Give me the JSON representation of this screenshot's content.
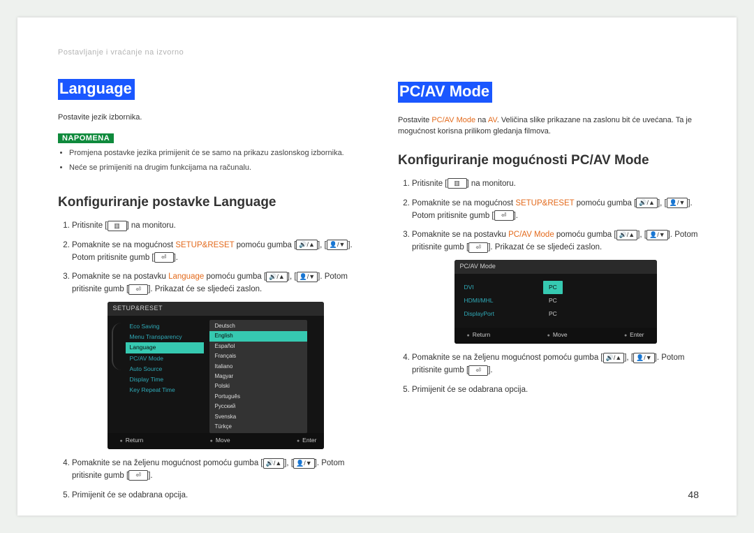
{
  "breadcrumb": "Postavljanje i vraćanje na izvorno",
  "pageNumber": "48",
  "left": {
    "heading": "Language",
    "intro": "Postavite jezik izbornika.",
    "noteLabel": "NAPOMENA",
    "notes": [
      "Promjena postavke jezika primijenit će se samo na prikazu zaslonskog izbornika.",
      "Neće se primijeniti na drugim funkcijama na računalu."
    ],
    "subheading": "Konfiguriranje postavke Language",
    "s1a": "Pritisnite [",
    "s1b": "] na monitoru.",
    "s2a": "Pomaknite se na mogućnost ",
    "s2kw": "SETUP&RESET",
    "s2b": " pomoću gumba [",
    "s2c": "], [",
    "s2d": "]. Potom pritisnite gumb [",
    "s2e": "].",
    "s3a": "Pomaknite se na postavku ",
    "s3kw": "Language",
    "s3b": " pomoću gumba [",
    "s3c": "], [",
    "s3d": "]. Potom pritisnite gumb [",
    "s3e": "]. Prikazat će se sljedeći zaslon.",
    "s4a": "Pomaknite se na željenu mogućnost pomoću gumba [",
    "s4b": "], [",
    "s4c": "]. Potom pritisnite gumb [",
    "s4d": "].",
    "s5": "Primijenit će se odabrana opcija."
  },
  "right": {
    "heading": "PC/AV Mode",
    "introA": "Postavite ",
    "introKW1": "PC/AV Mode",
    "introB": " na ",
    "introKW2": "AV",
    "introC": ". Veličina slike prikazane na zaslonu bit će uvećana. Ta je mogućnost korisna prilikom gledanja filmova.",
    "subheading": "Konfiguriranje mogućnosti PC/AV Mode",
    "s1a": "Pritisnite [",
    "s1b": "] na monitoru.",
    "s2a": "Pomaknite se na mogućnost ",
    "s2kw": "SETUP&RESET",
    "s2b": " pomoću gumba [",
    "s2c": "], [",
    "s2d": "]. Potom pritisnite gumb [",
    "s2e": "].",
    "s3a": "Pomaknite se na postavku ",
    "s3kw": "PC/AV Mode",
    "s3b": " pomoću gumba [",
    "s3c": "], [",
    "s3d": "]. Potom pritisnite gumb [",
    "s3e": "]. Prikazat će se sljedeći zaslon.",
    "s4a": "Pomaknite se na željenu mogućnost pomoću gumba [",
    "s4b": "], [",
    "s4c": "]. Potom pritisnite gumb [",
    "s4d": "].",
    "s5": "Primijenit će se odabrana opcija."
  },
  "osd1": {
    "title": "SETUP&RESET",
    "menu": [
      "Eco Saving",
      "Menu Transparency",
      "Language",
      "PC/AV Mode",
      "Auto Source",
      "Display Time",
      "Key Repeat Time"
    ],
    "selectedMenuIndex": 2,
    "langs": [
      "Deutsch",
      "English",
      "Español",
      "Français",
      "Italiano",
      "Magyar",
      "Polski",
      "Português",
      "Русский",
      "Svenska",
      "Türkçe"
    ],
    "selectedLangIndex": 1,
    "footer": {
      "return": "Return",
      "move": "Move",
      "enter": "Enter"
    }
  },
  "osd2": {
    "title": "PC/AV Mode",
    "labels": [
      "DVI",
      "HDMI/MHL",
      "DisplayPort"
    ],
    "values": [
      "PC",
      "PC",
      "PC"
    ],
    "selectedValueIndex": 0,
    "footer": {
      "return": "Return",
      "move": "Move",
      "enter": "Enter"
    }
  }
}
